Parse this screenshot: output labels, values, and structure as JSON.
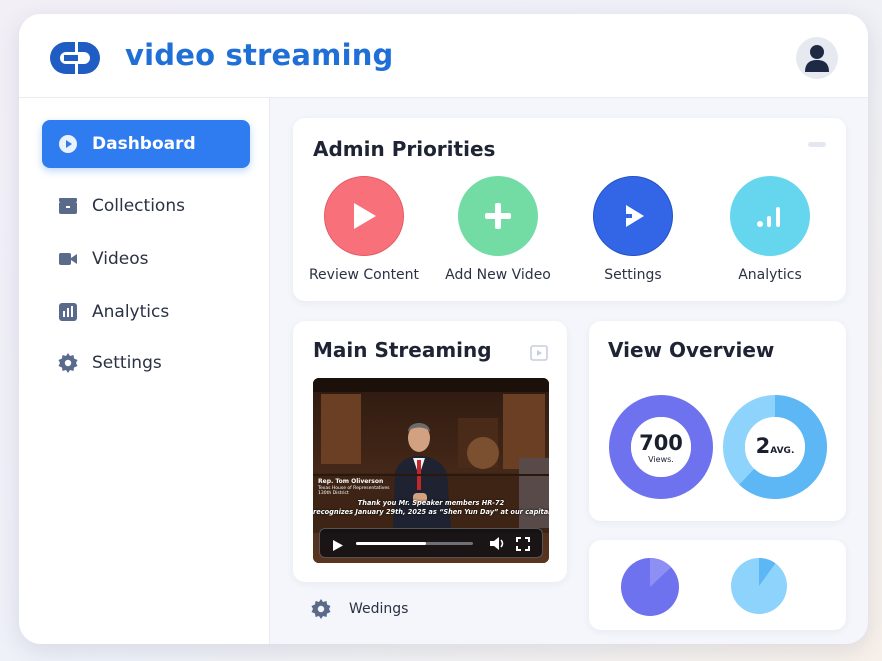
{
  "app": {
    "title": "video streaming"
  },
  "sidebar": {
    "items": [
      {
        "label": "Dashboard",
        "icon": "play-circle-icon",
        "active": true
      },
      {
        "label": "Collections",
        "icon": "folder-icon",
        "active": false
      },
      {
        "label": "Videos",
        "icon": "video-camera-icon",
        "active": false
      },
      {
        "label": "Analytics",
        "icon": "bar-chart-icon",
        "active": false
      },
      {
        "label": "Settings",
        "icon": "gear-icon",
        "active": false
      }
    ]
  },
  "admin_priorities": {
    "title": "Admin Priorities",
    "items": [
      {
        "label": "Review Content",
        "icon": "play-icon",
        "color": "#f7707a"
      },
      {
        "label": "Add New Video",
        "icon": "plus-icon",
        "color": "#72dca4"
      },
      {
        "label": "Settings",
        "icon": "play-icon",
        "color": "#3366e6"
      },
      {
        "label": "Analytics",
        "icon": "signal-bars-icon",
        "color": "#66d6ef"
      }
    ]
  },
  "main_streaming": {
    "title": "Main Streaming",
    "caption_name": "Rep. Tom Oliverson",
    "caption_role": "Texas House of Representatives",
    "caption_district": "130th District",
    "subtitle_line1": "Thank you Mr. Speaker members HR-72",
    "subtitle_line2": "recognizes January 29th, 2025 as “Shen Yun Day” at our capital.",
    "progress": 0.6
  },
  "footer_item": {
    "label": "Wedings",
    "icon": "gear-icon"
  },
  "view_overview": {
    "title": "View Overview",
    "views": {
      "value": "700",
      "unit": "Views.",
      "color": "#6f72ee"
    },
    "avg": {
      "value": "2",
      "unit": "AVG.",
      "color": "#5db7f4",
      "light_color": "#8ed3fb",
      "fraction": 0.62
    }
  },
  "mini_pies": [
    {
      "color": "#6f72ee",
      "light_color": "#8d8ff4",
      "fraction": 0.13
    },
    {
      "color": "#5db7f4",
      "light_color": "#8ed3fb",
      "fraction": 0.1
    }
  ],
  "colors": {
    "accent": "#2f7bf0",
    "brand": "#1f6fd6"
  }
}
